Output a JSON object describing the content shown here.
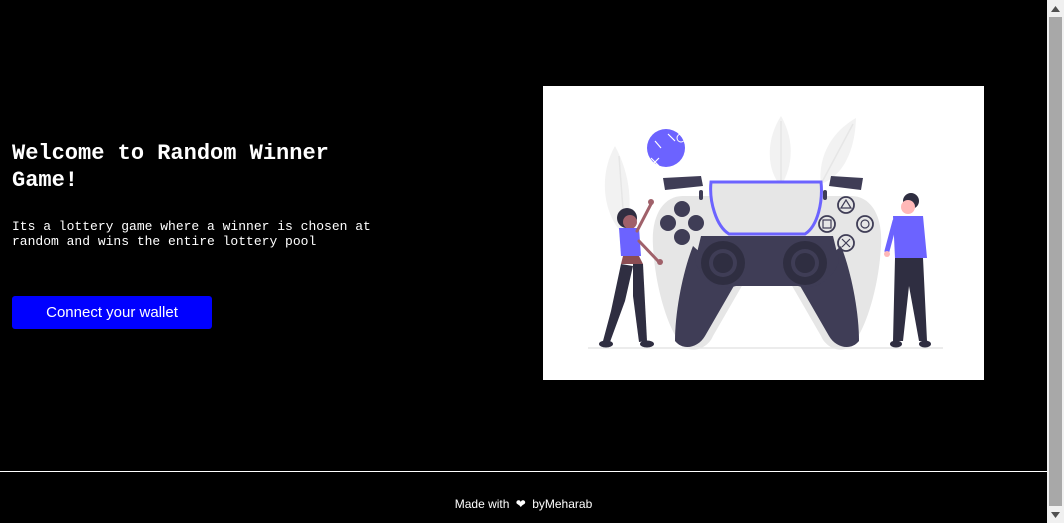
{
  "hero": {
    "title": "Welcome to Random Winner Game!",
    "description": "Its a lottery game where a winner is chosen at random and wins the entire lottery pool",
    "connect_button_label": "Connect your wallet"
  },
  "illustration": {
    "icon": "game-controller-illustration"
  },
  "footer": {
    "text_before": "Made with",
    "heart_glyph": "❤",
    "text_after": "byMeharab"
  },
  "colors": {
    "background": "#000000",
    "button": "#0000ff",
    "accent_purple": "#6c63ff",
    "controller_dark": "#3f3d56"
  }
}
